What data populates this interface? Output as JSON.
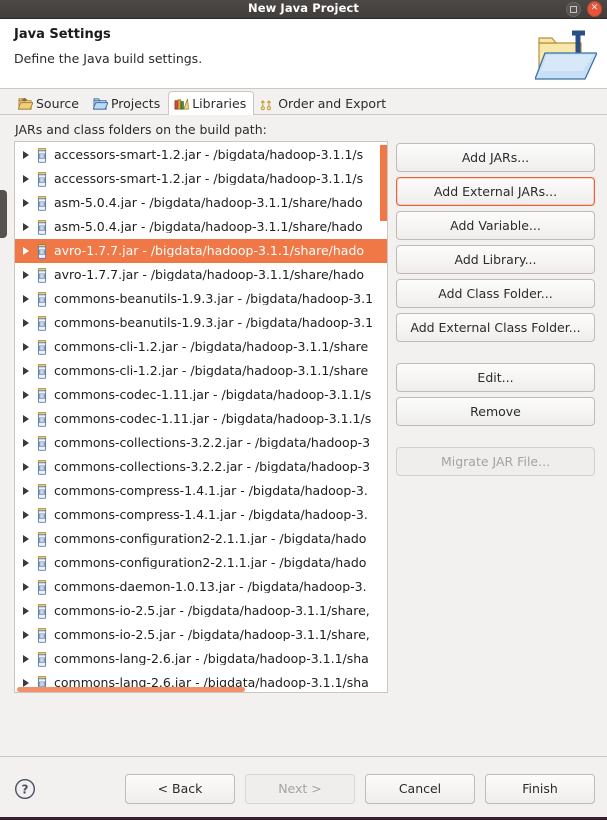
{
  "window": {
    "title": "New Java Project",
    "controls": [
      {
        "name": "maximize-button",
        "glyph": "maximize-icon"
      },
      {
        "name": "close-button",
        "glyph": "close-icon"
      }
    ]
  },
  "banner": {
    "title": "Java Settings",
    "description": "Define the Java build settings.",
    "icon": "java-folder-icon"
  },
  "tabs": [
    {
      "label": "Source",
      "icon": "source-folder-icon",
      "active": false
    },
    {
      "label": "Projects",
      "icon": "projects-folder-icon",
      "active": false
    },
    {
      "label": "Libraries",
      "icon": "libraries-books-icon",
      "active": true
    },
    {
      "label": "Order and Export",
      "icon": "order-export-arrows-icon",
      "active": false
    }
  ],
  "list": {
    "label": "JARs and class folders on the build path:",
    "selected_index": 4,
    "items": [
      "accessors-smart-1.2.jar - /bigdata/hadoop-3.1.1/s",
      "accessors-smart-1.2.jar - /bigdata/hadoop-3.1.1/s",
      "asm-5.0.4.jar - /bigdata/hadoop-3.1.1/share/hado",
      "asm-5.0.4.jar - /bigdata/hadoop-3.1.1/share/hado",
      "avro-1.7.7.jar - /bigdata/hadoop-3.1.1/share/hado",
      "avro-1.7.7.jar - /bigdata/hadoop-3.1.1/share/hado",
      "commons-beanutils-1.9.3.jar - /bigdata/hadoop-3.1",
      "commons-beanutils-1.9.3.jar - /bigdata/hadoop-3.1",
      "commons-cli-1.2.jar - /bigdata/hadoop-3.1.1/share",
      "commons-cli-1.2.jar - /bigdata/hadoop-3.1.1/share",
      "commons-codec-1.11.jar - /bigdata/hadoop-3.1.1/s",
      "commons-codec-1.11.jar - /bigdata/hadoop-3.1.1/s",
      "commons-collections-3.2.2.jar - /bigdata/hadoop-3",
      "commons-collections-3.2.2.jar - /bigdata/hadoop-3",
      "commons-compress-1.4.1.jar - /bigdata/hadoop-3.",
      "commons-compress-1.4.1.jar - /bigdata/hadoop-3.",
      "commons-configuration2-2.1.1.jar - /bigdata/hado",
      "commons-configuration2-2.1.1.jar - /bigdata/hado",
      "commons-daemon-1.0.13.jar - /bigdata/hadoop-3.",
      "commons-io-2.5.jar - /bigdata/hadoop-3.1.1/share,",
      "commons-io-2.5.jar - /bigdata/hadoop-3.1.1/share,",
      "commons-lang-2.6.jar - /bigdata/hadoop-3.1.1/sha",
      "commons-lang-2.6.jar - /bigdata/hadoop-3.1.1/sha"
    ]
  },
  "side_buttons": [
    {
      "label": "Add JARs...",
      "name": "add-jars-button",
      "state": "normal"
    },
    {
      "label": "Add External JARs...",
      "name": "add-external-jars-button",
      "state": "focused"
    },
    {
      "label": "Add Variable...",
      "name": "add-variable-button",
      "state": "normal"
    },
    {
      "label": "Add Library...",
      "name": "add-library-button",
      "state": "normal"
    },
    {
      "label": "Add Class Folder...",
      "name": "add-class-folder-button",
      "state": "normal"
    },
    {
      "label": "Add External Class Folder...",
      "name": "add-external-class-folder-button",
      "state": "normal"
    },
    {
      "label": "Edit...",
      "name": "edit-button",
      "state": "normal",
      "gap_before": true
    },
    {
      "label": "Remove",
      "name": "remove-button",
      "state": "normal"
    },
    {
      "label": "Migrate JAR File...",
      "name": "migrate-jar-file-button",
      "state": "disabled",
      "gap_before": true
    }
  ],
  "footer": {
    "help_icon": "help-question-icon",
    "buttons": [
      {
        "label": "< Back",
        "name": "back-button",
        "state": "normal"
      },
      {
        "label": "Next >",
        "name": "next-button",
        "state": "disabled"
      },
      {
        "label": "Cancel",
        "name": "cancel-button",
        "state": "normal"
      },
      {
        "label": "Finish",
        "name": "finish-button",
        "state": "normal"
      }
    ]
  },
  "colors": {
    "selection": "#f07746",
    "scrollbar": "#f07746",
    "titlebar": "#413e3c",
    "close_button": "#e2563a",
    "focus_border": "#e8633a"
  }
}
